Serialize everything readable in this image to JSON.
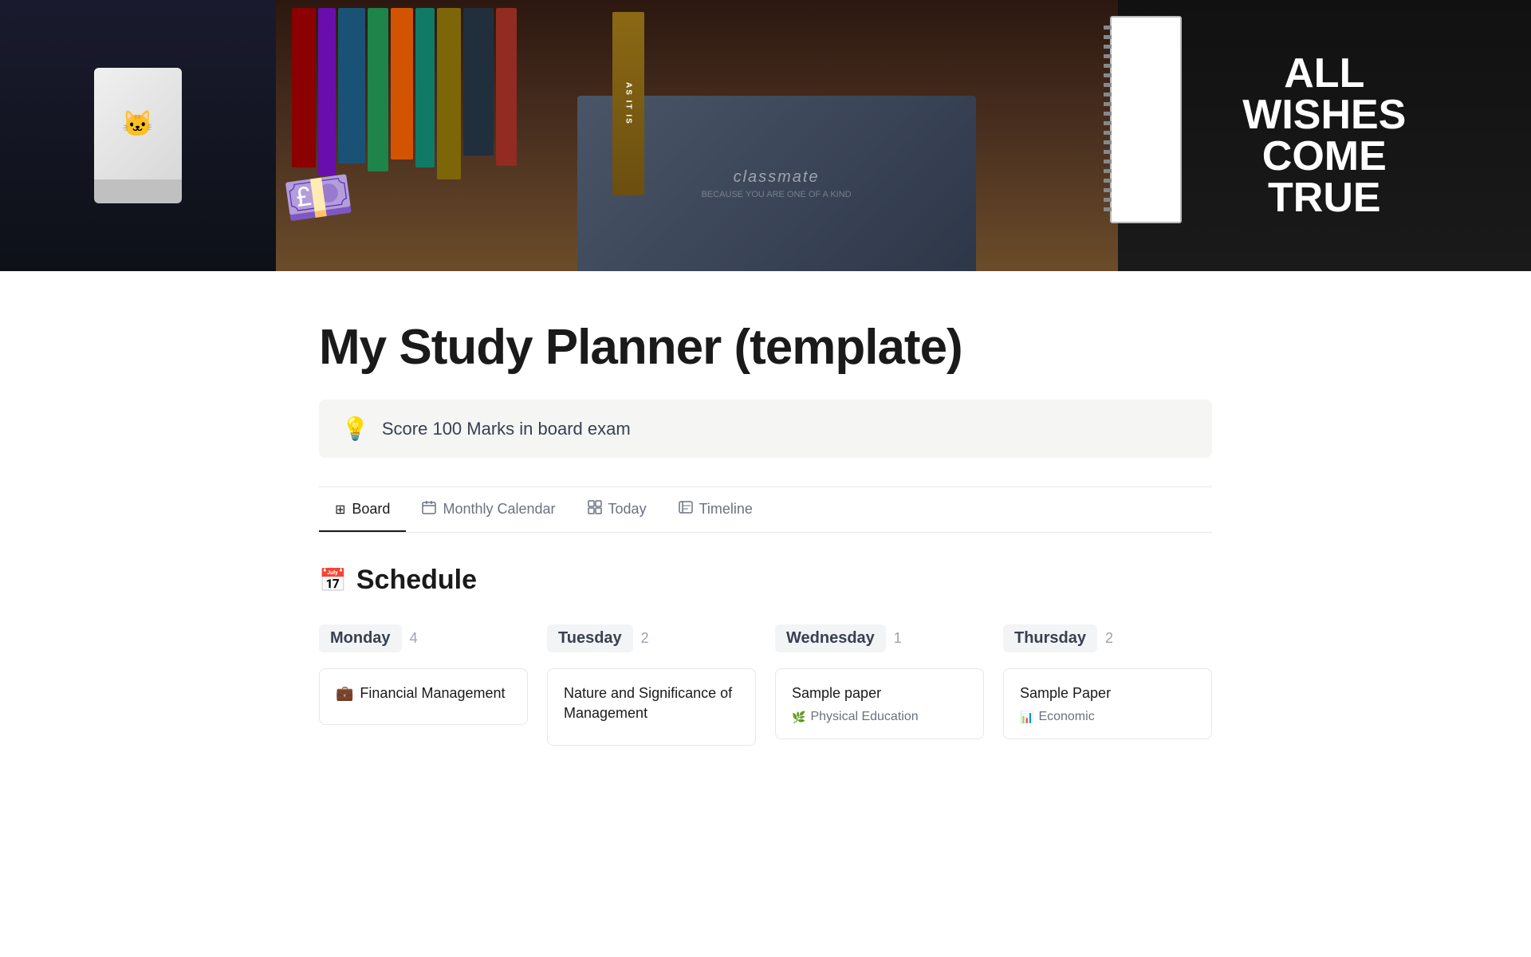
{
  "page": {
    "title": "My Study Planner (template)",
    "goal_icon": "💡",
    "goal_text": "Score 100 Marks in board exam",
    "money_emoji": "💷",
    "all_wishes_text": "ALL WISHES Come TRUE"
  },
  "tabs": [
    {
      "id": "board",
      "label": "Board",
      "icon": "⊞",
      "active": true
    },
    {
      "id": "monthly-calendar",
      "label": "Monthly Calendar",
      "icon": "▦",
      "active": false
    },
    {
      "id": "today",
      "label": "Today",
      "icon": "▦",
      "active": false
    },
    {
      "id": "timeline",
      "label": "Timeline",
      "icon": "▦",
      "active": false
    }
  ],
  "schedule": {
    "emoji": "📅",
    "title": "Schedule"
  },
  "columns": [
    {
      "day": "Monday",
      "count": 4,
      "cards": [
        {
          "title": "Financial Management",
          "subtitle_icon": "💼",
          "subtitle": ""
        }
      ]
    },
    {
      "day": "Tuesday",
      "count": 2,
      "cards": [
        {
          "title": "Nature and Significance of Management",
          "subtitle_icon": "",
          "subtitle": ""
        }
      ]
    },
    {
      "day": "Wednesday",
      "count": 1,
      "cards": [
        {
          "title": "Sample paper",
          "subtitle_icon": "🌿",
          "subtitle": "Physical Education"
        }
      ]
    },
    {
      "day": "Thursday",
      "count": 2,
      "cards": [
        {
          "title": "Sample Paper",
          "subtitle_icon": "📊",
          "subtitle": "Economic"
        }
      ]
    }
  ],
  "books": [
    "b1",
    "b2",
    "b3",
    "b4",
    "b5",
    "b6",
    "b7",
    "b8",
    "b9",
    "b10"
  ],
  "colors": {
    "active_tab_border": "#1a1a1a",
    "background": "#ffffff",
    "card_border": "#e5e7eb"
  }
}
